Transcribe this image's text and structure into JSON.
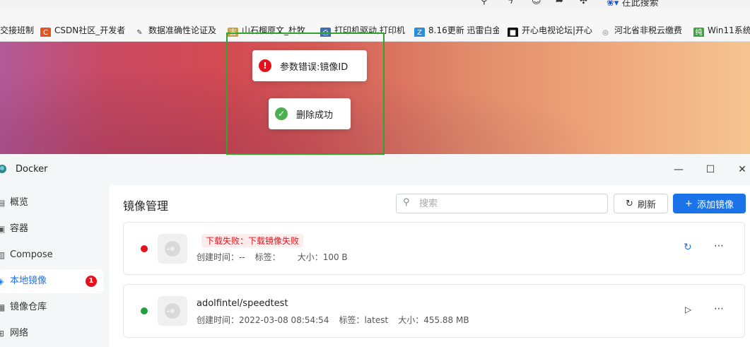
{
  "browser": {
    "search_label": "在此搜索",
    "bookmarks": [
      {
        "label": "交接班制",
        "icon": "doc-icon",
        "color": "#888888"
      },
      {
        "label": "CSDN社区_开发者",
        "icon": "csdn-icon",
        "color": "#e5541f"
      },
      {
        "label": "数据准确性论证及",
        "icon": "feather-icon",
        "color": "#555555"
      },
      {
        "label": "山石榴原文_杜牧",
        "icon": "gushiwen-icon",
        "color": "#b08a3a"
      },
      {
        "label": "打印机驱动,打印机",
        "icon": "printer-icon",
        "color": "#3a6fb0"
      },
      {
        "label": "8.16更新 迅雷白金",
        "icon": "z-icon",
        "color": "#2b8de0"
      },
      {
        "label": "开心电视论坛|开心",
        "icon": "tv-icon",
        "color": "#111111"
      },
      {
        "label": "河北省非税云缴费",
        "icon": "globe-icon",
        "color": "#888888"
      },
      {
        "label": "Win11系统",
        "icon": "chun-icon",
        "color": "#3aa63a"
      }
    ]
  },
  "toasts": {
    "error": "参数错误:镜像ID",
    "success": "删除成功"
  },
  "window": {
    "title": "Docker",
    "minimize": "—",
    "maximize": "☐",
    "close": "✕"
  },
  "sidebar": {
    "items": [
      {
        "label": "概览",
        "icon": "overview-icon"
      },
      {
        "label": "容器",
        "icon": "container-icon"
      },
      {
        "label": "Compose",
        "icon": "compose-icon"
      },
      {
        "label": "本地镜像",
        "icon": "image-icon",
        "badge": "1"
      },
      {
        "label": "镜像仓库",
        "icon": "registry-icon"
      },
      {
        "label": "网络",
        "icon": "network-icon"
      }
    ]
  },
  "main": {
    "title": "镜像管理",
    "search_placeholder": "搜索",
    "refresh_label": "刷新",
    "add_label": "添加镜像"
  },
  "images": [
    {
      "status_color": "#e5111c",
      "error": "下载失败：下载镜像失败",
      "created": "创建时间：--",
      "tag": "标签：",
      "size": "大小：100 B"
    },
    {
      "status_color": "#22a03c",
      "name": "adolfintel/speedtest",
      "created": "创建时间：2022-03-08 08:54:54",
      "tag": "标签：latest",
      "size": "大小：455.88 MB"
    }
  ]
}
